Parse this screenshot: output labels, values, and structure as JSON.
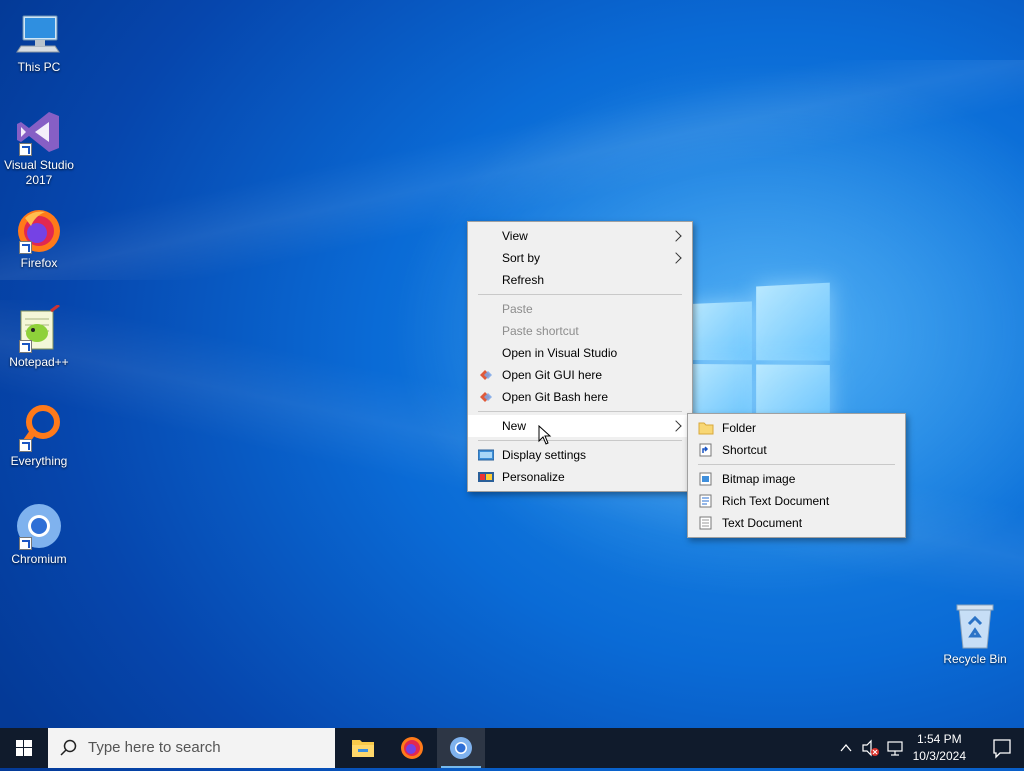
{
  "desktop": {
    "icons": [
      {
        "label": "This PC",
        "icon": "computer-icon"
      },
      {
        "label": "Visual Studio 2017",
        "icon": "visual-studio-icon"
      },
      {
        "label": "Firefox",
        "icon": "firefox-icon"
      },
      {
        "label": "Notepad++",
        "icon": "notepad-plus-plus-icon"
      },
      {
        "label": "Everything",
        "icon": "everything-search-icon"
      },
      {
        "label": "Chromium",
        "icon": "chromium-icon"
      },
      {
        "label": "Recycle Bin",
        "icon": "recycle-bin-icon"
      }
    ]
  },
  "context_menu": {
    "items": [
      {
        "label": "View",
        "submenu": true
      },
      {
        "label": "Sort by",
        "submenu": true
      },
      {
        "label": "Refresh"
      },
      {
        "label": "Paste",
        "disabled": true
      },
      {
        "label": "Paste shortcut",
        "disabled": true
      },
      {
        "label": "Open in Visual Studio"
      },
      {
        "label": "Open Git GUI here",
        "icon": "git-icon"
      },
      {
        "label": "Open Git Bash here",
        "icon": "git-icon"
      },
      {
        "label": "New",
        "submenu": true,
        "highlighted": true
      },
      {
        "label": "Display settings",
        "icon": "display-icon"
      },
      {
        "label": "Personalize",
        "icon": "personalize-icon"
      }
    ]
  },
  "new_submenu": {
    "items": [
      {
        "label": "Folder",
        "icon": "folder-icon"
      },
      {
        "label": "Shortcut",
        "icon": "shortcut-icon"
      },
      {
        "label": "Bitmap image",
        "icon": "bitmap-icon"
      },
      {
        "label": "Rich Text Document",
        "icon": "rich-text-icon"
      },
      {
        "label": "Text Document",
        "icon": "text-document-icon"
      }
    ]
  },
  "taskbar": {
    "search_placeholder": "Type here to search",
    "pinned": [
      "file-explorer-icon",
      "firefox-icon",
      "chromium-icon"
    ],
    "clock_time": "1:54 PM",
    "clock_date": "10/3/2024"
  },
  "colors": {
    "taskbar_bg": "#101b2c",
    "menu_bg": "#f0f0f0",
    "desktop_blue": "#0a6bd6"
  }
}
